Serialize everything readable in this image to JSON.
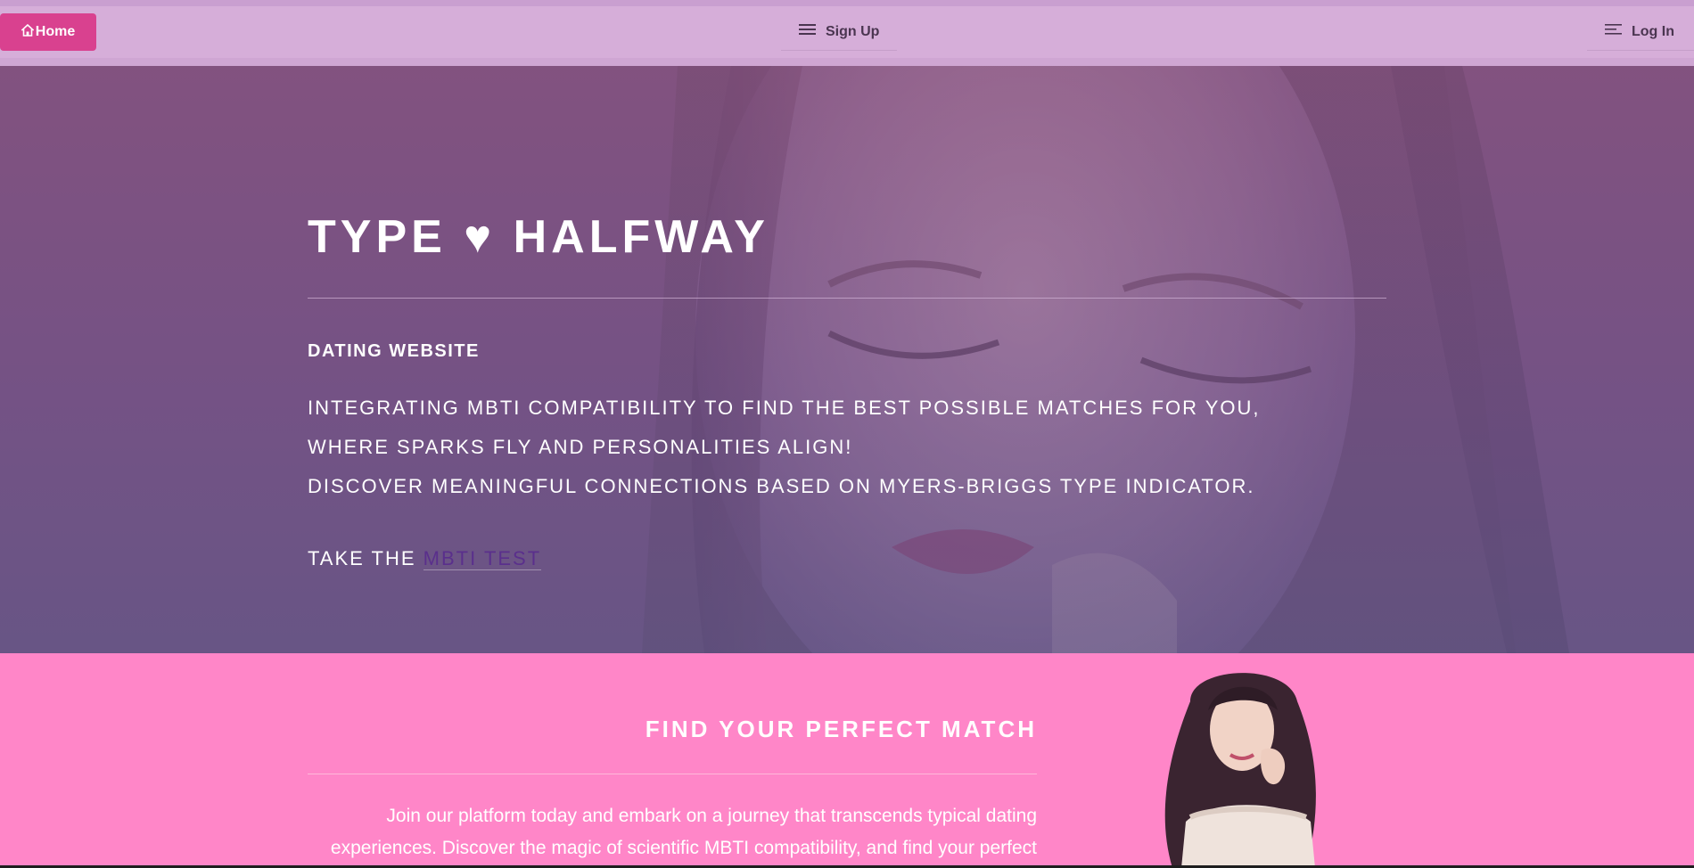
{
  "nav": {
    "home_label": "Home",
    "signup_label": "Sign Up",
    "login_label": "Log In"
  },
  "hero": {
    "title": "TYPE ♥ HALFWAY",
    "subtitle": "DATING WEBSITE",
    "lines": [
      "INTEGRATING MBTI COMPATIBILITY TO FIND THE BEST POSSIBLE MATCHES FOR YOU,",
      "WHERE SPARKS FLY AND PERSONALITIES ALIGN!",
      "DISCOVER MEANINGFUL CONNECTIONS BASED ON MYERS-BRIGGS TYPE INDICATOR."
    ],
    "cta_prefix": "TAKE THE",
    "cta_link": "MBTI TEST"
  },
  "match": {
    "title": "FIND YOUR PERFECT MATCH",
    "text_line1": "Join our platform today and embark on a journey that transcends typical dating",
    "text_line2": "experiences. Discover the magic of scientific MBTI compatibility, and find your perfect"
  },
  "colors": {
    "nav_bg": "#d6aed9",
    "home_button": "#d9418f",
    "section_pink": "#ff86c8",
    "link_purple": "#5a2f8c"
  },
  "icons": {
    "home": "home-icon",
    "signup": "menu-icon",
    "login": "menu-lines-icon"
  }
}
